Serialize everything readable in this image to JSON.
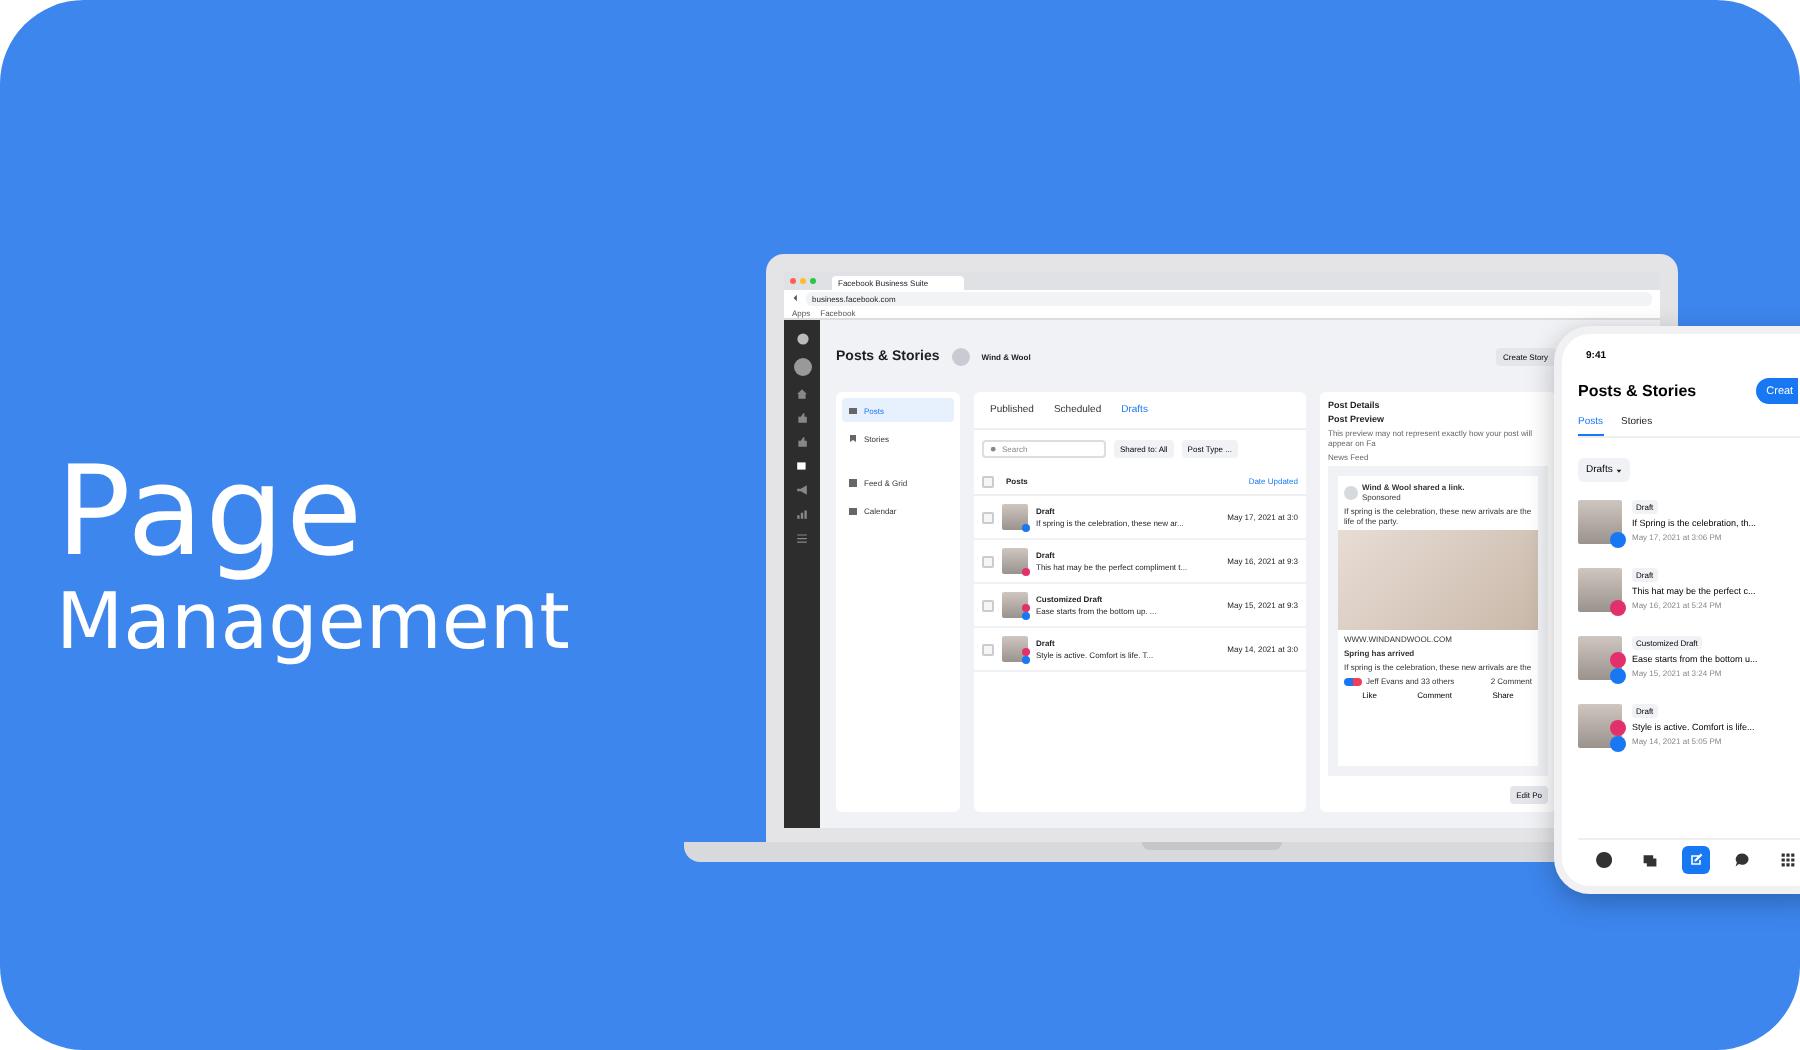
{
  "headline": {
    "line_1": "Page",
    "line_2": "Management"
  },
  "browser": {
    "tab_title": "Facebook Business Suite",
    "url": "business.facebook.com",
    "bookmarks": [
      "Apps",
      "Facebook"
    ]
  },
  "app": {
    "title": "Posts & Stories",
    "account": "Wind & Wool",
    "create_button": "Create Story",
    "nav": [
      {
        "label": "Posts",
        "selected": true
      },
      {
        "label": "Stories",
        "selected": false
      },
      {
        "label": "Feed & Grid",
        "selected": false
      },
      {
        "label": "Calendar",
        "selected": false
      }
    ],
    "tabs": [
      {
        "label": "Published",
        "selected": false
      },
      {
        "label": "Scheduled",
        "selected": false
      },
      {
        "label": "Drafts",
        "selected": true
      }
    ],
    "search": {
      "placeholder": "Search"
    },
    "filters": [
      "Shared to: All",
      "Post Type ..."
    ],
    "columns": [
      "Posts",
      "Date Updated"
    ],
    "select_all_checked": false,
    "rows": [
      {
        "checked": false,
        "label": "Draft",
        "text": "If spring is the celebration, these new ar...",
        "date": "May 17, 2021 at 3:0",
        "badges": [
          {
            "color": "#1877f2"
          }
        ]
      },
      {
        "checked": false,
        "label": "Draft",
        "text": "This hat may be the perfect compliment t...",
        "date": "May 16, 2021 at 9:3",
        "badges": [
          {
            "color": "#e1306c"
          }
        ]
      },
      {
        "checked": false,
        "label": "Customized Draft",
        "text": "Ease starts from the bottom up. ...",
        "date": "May 15, 2021 at 9:3",
        "badges": [
          {
            "color": "#e1306c"
          },
          {
            "color": "#1877f2"
          }
        ]
      },
      {
        "checked": false,
        "label": "Draft",
        "text": "Style is active. Comfort is life. T...",
        "date": "May 14, 2021 at 3:0",
        "badges": [
          {
            "color": "#e1306c"
          },
          {
            "color": "#1877f2"
          }
        ]
      }
    ],
    "details": {
      "title": "Post Details",
      "preview_title": "Post Preview",
      "preview_note": [
        "This preview may not represent exactly how your post will appear on Fa",
        "News Feed"
      ],
      "post": {
        "author": "Wind & Wool shared a link.",
        "sponsored": "Sponsored",
        "caption": "If spring is the celebration, these new arrivals are the life of the party.",
        "domain": "WWW.WINDANDWOOL.COM",
        "link_title": "Spring has arrived",
        "link_text": "If spring is the celebration, these new arrivals are the",
        "reactions": "Jeff Evans and 33 others",
        "comments": "2 Comment",
        "actions": [
          "Like",
          "Comment",
          "Share"
        ]
      },
      "edit_button": "Edit Po"
    }
  },
  "phone": {
    "time": "9:41",
    "title": "Posts & Stories",
    "create_button": "Creat",
    "tabs": [
      {
        "label": "Posts",
        "selected": true
      },
      {
        "label": "Stories",
        "selected": false
      }
    ],
    "filter": "Drafts",
    "rows": [
      {
        "label": "Draft",
        "text": "If Spring is the celebration, th...",
        "date": "May 17, 2021 at 3:06 PM",
        "badges": [
          {
            "color": "#1877f2"
          }
        ]
      },
      {
        "label": "Draft",
        "text": "This hat may be the perfect c...",
        "date": "May 16, 2021 at 5:24 PM",
        "badges": [
          {
            "color": "#e1306c"
          }
        ]
      },
      {
        "label": "Customized Draft",
        "text": "Ease starts from the bottom u...",
        "date": "May 15, 2021 at 3:24 PM",
        "badges": [
          {
            "color": "#e1306c"
          },
          {
            "color": "#1877f2"
          }
        ]
      },
      {
        "label": "Draft",
        "text": "Style is active. Comfort is life...",
        "date": "May 14, 2021 at 5:05 PM",
        "badges": [
          {
            "color": "#e1306c"
          },
          {
            "color": "#1877f2"
          }
        ]
      }
    ],
    "bottom_nav": [
      {
        "selected": false
      },
      {
        "selected": false
      },
      {
        "selected": true
      },
      {
        "selected": false
      },
      {
        "selected": false
      }
    ]
  }
}
